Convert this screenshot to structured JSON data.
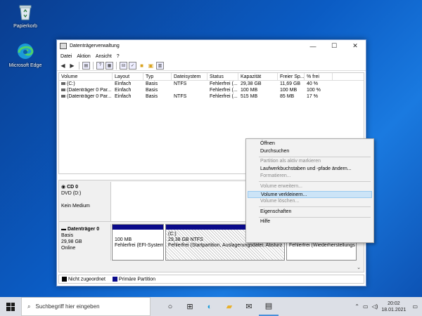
{
  "desktop": {
    "icons": [
      {
        "label": "Papierkorb"
      },
      {
        "label": "Microsoft Edge"
      }
    ]
  },
  "window": {
    "title": "Datenträgerverwaltung",
    "controls": {
      "minimize": "—",
      "maximize": "☐",
      "close": "✕"
    },
    "menu": [
      "Datei",
      "Aktion",
      "Ansicht",
      "?"
    ]
  },
  "volume_list": {
    "columns": [
      "Volume",
      "Layout",
      "Typ",
      "Dateisystem",
      "Status",
      "Kapazität",
      "Freier Sp...",
      "% frei"
    ],
    "rows": [
      [
        "(C:)",
        "Einfach",
        "Basis",
        "NTFS",
        "Fehlerfrei (...",
        "29,38 GB",
        "11,69 GB",
        "40 %"
      ],
      [
        "(Datenträger 0 Par...",
        "Einfach",
        "Basis",
        "",
        "Fehlerfrei (...",
        "100 MB",
        "100 MB",
        "100 %"
      ],
      [
        "(Datenträger 0 Par...",
        "Einfach",
        "Basis",
        "NTFS",
        "Fehlerfrei (...",
        "515 MB",
        "85 MB",
        "17 %"
      ]
    ]
  },
  "disks": [
    {
      "name": "CD 0",
      "lines": [
        "DVD (D:)",
        "",
        "Kein Medium"
      ]
    },
    {
      "name": "Datenträger 0",
      "lines": [
        "Basis",
        "29,98 GB",
        "Online"
      ],
      "partitions": [
        {
          "title": "",
          "lines": [
            "100 MB",
            "Fehlerfrei (EFI-System"
          ]
        },
        {
          "title": "(C:)",
          "lines": [
            "29,38 GB NTFS",
            "Fehlerfrei (Startpartition, Auslagerungsdatei, Absturz"
          ]
        },
        {
          "title": "",
          "lines": [
            "",
            "Fehlerfrei (Wiederherstellungs"
          ]
        }
      ]
    }
  ],
  "legend": [
    {
      "label": "Nicht zugeordnet",
      "color": "#000000"
    },
    {
      "label": "Primäre Partition",
      "color": "#0a0a8a"
    }
  ],
  "context_menu": {
    "groups": [
      [
        {
          "label": "Öffnen",
          "enabled": true
        },
        {
          "label": "Durchsuchen",
          "enabled": true
        }
      ],
      [
        {
          "label": "Partition als aktiv markieren",
          "enabled": false
        },
        {
          "label": "Laufwerkbuchstaben und -pfade ändern...",
          "enabled": true
        },
        {
          "label": "Formatieren...",
          "enabled": false
        }
      ],
      [
        {
          "label": "Volume erweitern...",
          "enabled": false
        },
        {
          "label": "Volume verkleinern...",
          "enabled": true,
          "highlighted": true
        },
        {
          "label": "Volume löschen...",
          "enabled": false
        }
      ],
      [
        {
          "label": "Eigenschaften",
          "enabled": true
        }
      ],
      [
        {
          "label": "Hilfe",
          "enabled": true
        }
      ]
    ]
  },
  "taskbar": {
    "search_placeholder": "Suchbegriff hier eingeben",
    "time": "20:02",
    "date": "18.01.2021",
    "accent": "#4a90d9"
  }
}
